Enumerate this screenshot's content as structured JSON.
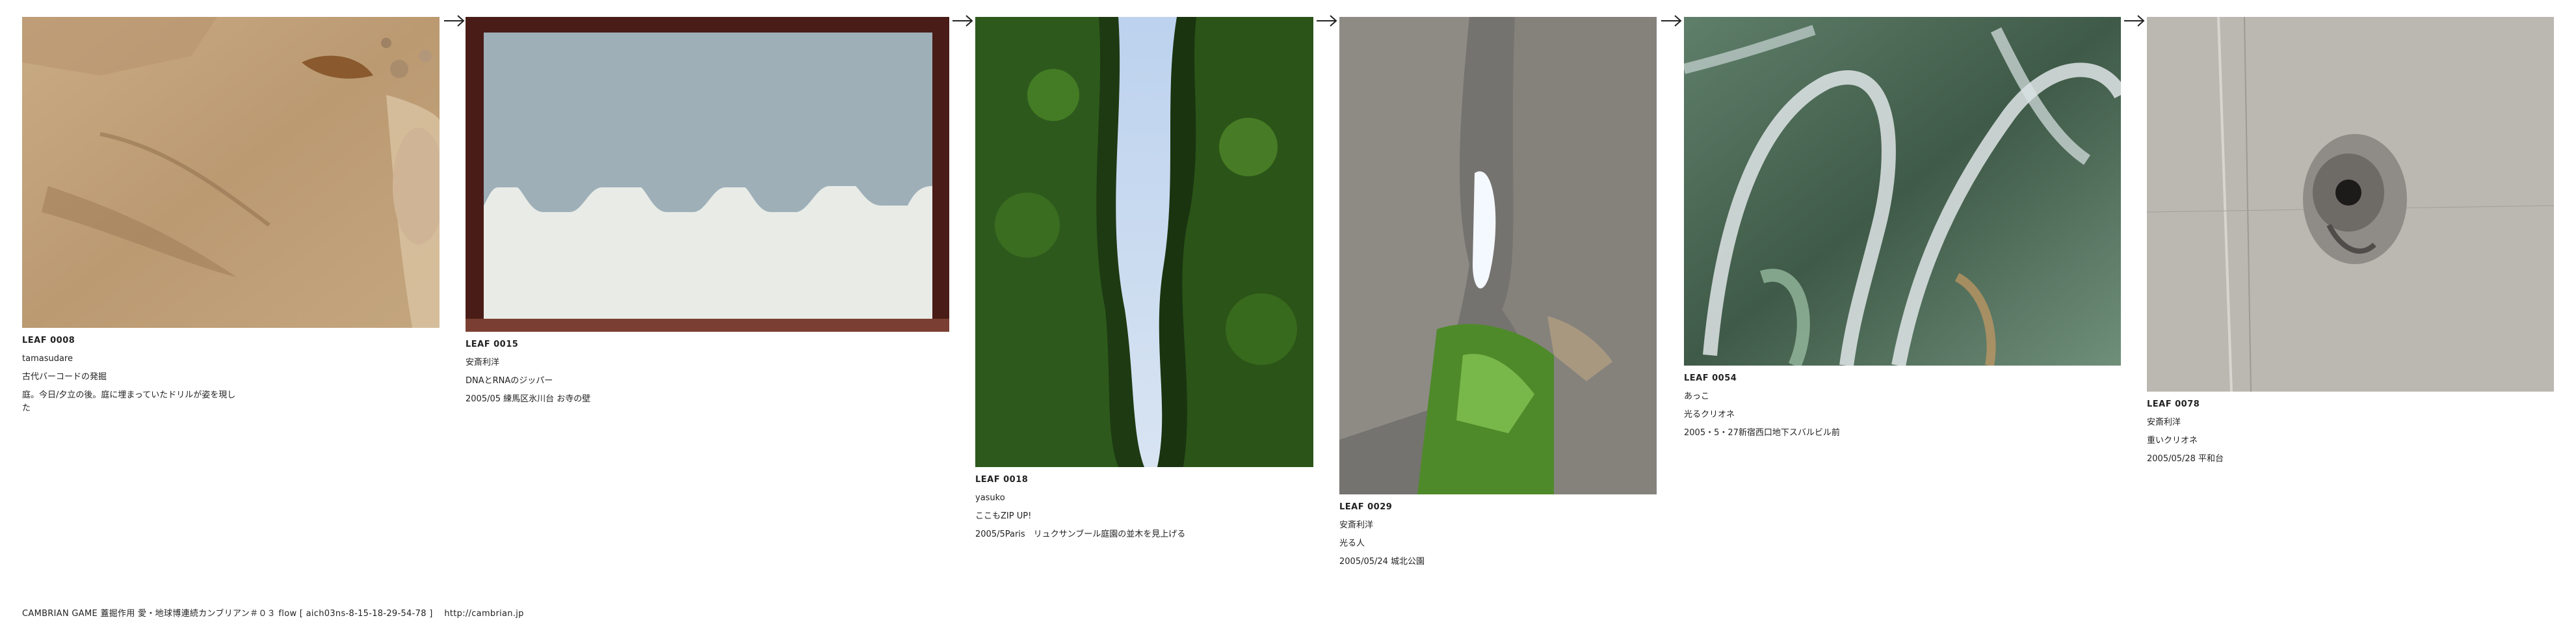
{
  "leaves": [
    {
      "id": "LEAF 0008",
      "author": "tamasudare",
      "title": "古代バーコードの発掘",
      "note": "庭。今日/夕立の後。庭に埋まっていたドリルが姿を現した"
    },
    {
      "id": "LEAF 0015",
      "author": "安斎利洋",
      "title": "DNAとRNAのジッパー",
      "note": "2005/05 練馬区氷川台 お寺の壁"
    },
    {
      "id": "LEAF 0018",
      "author": "yasuko",
      "title": "ここもZIP UP!",
      "note": "2005/5Paris　リュクサンブール庭園の並木を見上げる"
    },
    {
      "id": "LEAF 0029",
      "author": "安斎利洋",
      "title": "光る人",
      "note": "2005/05/24 城北公園"
    },
    {
      "id": "LEAF 0054",
      "author": "あっこ",
      "title": "光るクリオネ",
      "note": "2005・5・27新宿西口地下スバルビル前"
    },
    {
      "id": "LEAF 0078",
      "author": "安斎利洋",
      "title": "重いクリオネ",
      "note": "2005/05/28 平和台"
    }
  ],
  "icons": {
    "arrow": "right-arrow-icon"
  },
  "footer": {
    "text": "CAMBRIAN GAME  蓋掘作用 愛・地球博連続カンブリアン＃０３ flow [ aich03ns-8-15-18-29-54-78 ]",
    "link": "http://cambrian.jp"
  }
}
